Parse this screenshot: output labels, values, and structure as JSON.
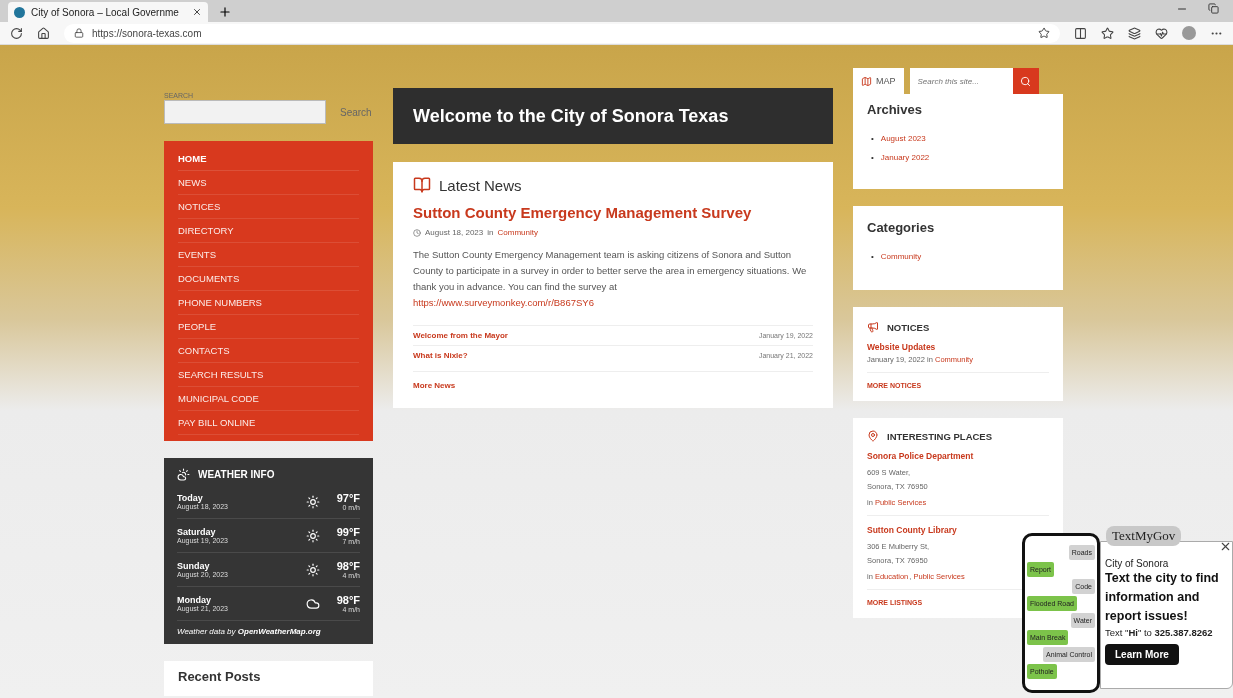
{
  "browser": {
    "tab_title": "City of Sonora – Local Governme",
    "url": "https://sonora-texas.com"
  },
  "search": {
    "label": "SEARCH",
    "button": "Search"
  },
  "nav": [
    {
      "label": "HOME",
      "selected": true
    },
    {
      "label": "NEWS",
      "selected": false
    },
    {
      "label": "NOTICES",
      "selected": false
    },
    {
      "label": "DIRECTORY",
      "selected": false
    },
    {
      "label": "EVENTS",
      "selected": false
    },
    {
      "label": "DOCUMENTS",
      "selected": false
    },
    {
      "label": "PHONE NUMBERS",
      "selected": false
    },
    {
      "label": "PEOPLE",
      "selected": false
    },
    {
      "label": "CONTACTS",
      "selected": false
    },
    {
      "label": "SEARCH RESULTS",
      "selected": false
    },
    {
      "label": "MUNICIPAL CODE",
      "selected": false
    },
    {
      "label": "PAY BILL ONLINE",
      "selected": false
    }
  ],
  "weather": {
    "title": "WEATHER INFO",
    "days": [
      {
        "day": "Today",
        "date": "August 18, 2023",
        "kind": "sun",
        "temp": "97°F",
        "wind": "0 m/h"
      },
      {
        "day": "Saturday",
        "date": "August 19, 2023",
        "kind": "sun",
        "temp": "99°F",
        "wind": "7 m/h"
      },
      {
        "day": "Sunday",
        "date": "August 20, 2023",
        "kind": "sun",
        "temp": "98°F",
        "wind": "4 m/h"
      },
      {
        "day": "Monday",
        "date": "August 21, 2023",
        "kind": "cloud",
        "temp": "98°F",
        "wind": "4 m/h"
      }
    ],
    "credit": "Weather data by **OpenWeatherMap.org**"
  },
  "recent_posts": {
    "title": "Recent Posts"
  },
  "welcome": "Welcome to the City of Sonora Texas",
  "news": {
    "title": "Latest News",
    "headline": "Sutton County Emergency Management Survey",
    "date": "August 18, 2023",
    "in": "in",
    "category": "Community",
    "body": "The Sutton County Emergency Management team is asking citizens of Sonora and Sutton County to participate in a survey in order to better serve the area in emergency situations. We thank you in advance. You can find the survey at",
    "link": "https://www.surveymonkey.com/r/B867SY6",
    "items": [
      {
        "title": "Welcome from the Mayor",
        "date": "January 19, 2022"
      },
      {
        "title": "What is Nixle?",
        "date": "January 21, 2022"
      }
    ],
    "more": "More News"
  },
  "map": "MAP",
  "site_search": {
    "placeholder": "Search this site..."
  },
  "archives": {
    "title": "Archives",
    "marker": "•",
    "items": [
      "August 2023",
      "January 2022"
    ]
  },
  "categories": {
    "title": "Categories",
    "marker": "•",
    "items": [
      "Community"
    ]
  },
  "notices": {
    "title": "NOTICES",
    "item": "Website Updates",
    "date": "January 19, 2022",
    "in": "in",
    "category": "Community",
    "more": "MORE NOTICES"
  },
  "places": {
    "title": "INTERESTING PLACES",
    "separator": ",",
    "items": [
      {
        "name": "Sonora Police Department",
        "address": [
          "609 S Water,",
          "Sonora, TX 76950"
        ],
        "in": "in",
        "categories": [
          "Public Services"
        ]
      },
      {
        "name": "Sutton County Library",
        "address": [
          "306 E Mulberry St,",
          "Sonora, TX 76950"
        ],
        "in": "in",
        "categories": [
          "Education",
          "Public Services"
        ]
      }
    ],
    "more": "MORE LISTINGS"
  },
  "popup": {
    "brand": "TextMyGov",
    "city": "City of Sonora",
    "headline": "Text the city to find information and report issues!",
    "cta": "Text \"**Hi**\" to **325.387.8262**",
    "button": "Learn More",
    "bubbles": [
      {
        "text": "Roads",
        "kind": "incoming"
      },
      {
        "text": "Report",
        "kind": "outgoing"
      },
      {
        "text": "Code",
        "kind": "incoming"
      },
      {
        "text": "Flooded Road",
        "kind": "outgoing"
      },
      {
        "text": "Water",
        "kind": "incoming"
      },
      {
        "text": "Main Break",
        "kind": "outgoing"
      },
      {
        "text": "Animal Control",
        "kind": "incoming"
      },
      {
        "text": "Pothole",
        "kind": "outgoing"
      }
    ]
  }
}
